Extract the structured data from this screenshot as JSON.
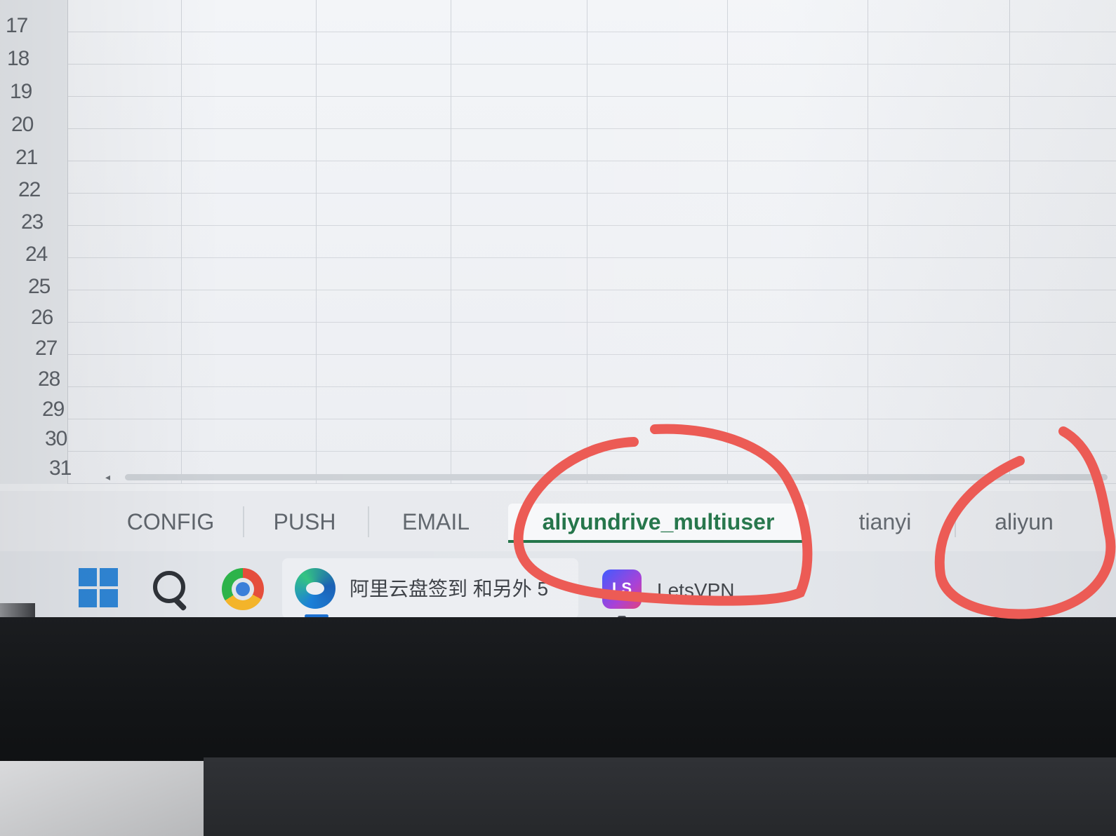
{
  "row_numbers": [
    "17",
    "18",
    "19",
    "20",
    "21",
    "22",
    "23",
    "24",
    "25",
    "26",
    "27",
    "28",
    "29",
    "30",
    "31"
  ],
  "scrollbar": {
    "left_arrow": "◂"
  },
  "sheet_tabs": [
    {
      "label": "CONFIG",
      "active": false
    },
    {
      "label": "PUSH",
      "active": false
    },
    {
      "label": "EMAIL",
      "active": false
    },
    {
      "label": "aliyundrive_multiuser",
      "active": true
    },
    {
      "label": "tianyi",
      "active": false
    },
    {
      "label": "aliyun",
      "active": false
    }
  ],
  "taskbar": {
    "start_icon": "windows-logo-icon",
    "search_icon": "search-icon",
    "app_icon": "app-orb-icon",
    "browser": {
      "icon": "edge-icon",
      "title": "阿里云盘签到 和另外 5"
    },
    "vpn": {
      "icon": "letsvpn-icon",
      "label": "LetsVPN"
    }
  },
  "colors": {
    "active_tab": "#1e7145",
    "annotation": "#ec5b55"
  }
}
